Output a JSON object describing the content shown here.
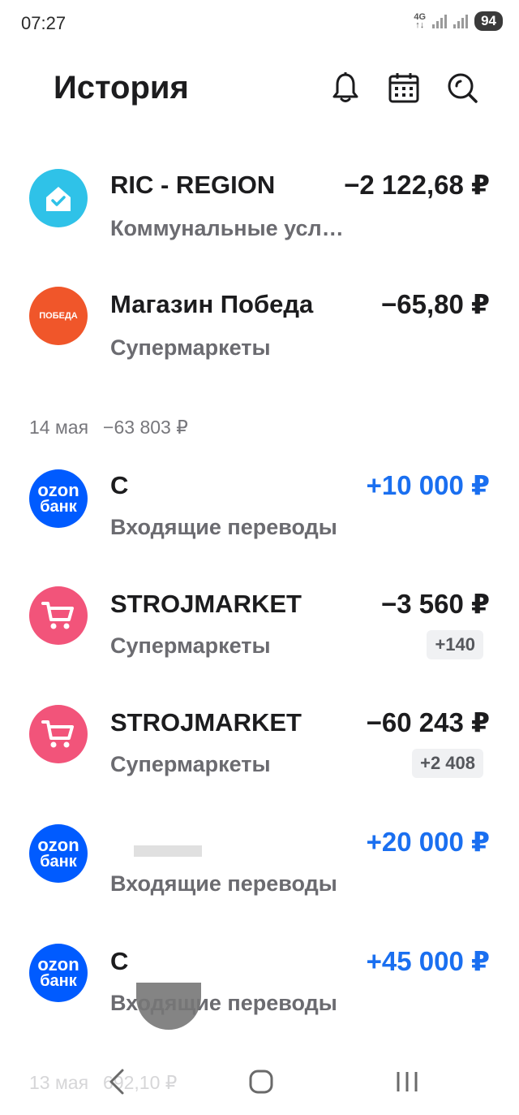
{
  "status": {
    "time": "07:27",
    "network": "4G",
    "battery": "94"
  },
  "header": {
    "title": "История"
  },
  "icons": {
    "bell": "bell-icon",
    "calendar": "calendar-icon",
    "search": "search-icon"
  },
  "colors": {
    "accent_blue": "#1a6ff0",
    "ozon_blue": "#005bff",
    "store_pink": "#f2547a",
    "pobeda_orange": "#f0562a",
    "ric_cyan": "#2fc2e8"
  },
  "transactions_top": [
    {
      "name": "RIC - REGION",
      "category": "Коммунальные усл…",
      "amount": "−2 122,68 ₽",
      "direction": "out",
      "logo": "house-logo"
    },
    {
      "name": "Магазин Победа",
      "category": "Супермаркеты",
      "amount": "−65,80 ₽",
      "direction": "out",
      "logo": "pobeda-logo",
      "logo_text": "ПОБЕДА"
    }
  ],
  "day_groups": [
    {
      "date": "14 мая",
      "total": "−63 803 ₽",
      "transactions": [
        {
          "name": "С",
          "category": "Входящие переводы",
          "amount": "+10 000 ₽",
          "direction": "in",
          "logo": "ozon-bank-logo"
        },
        {
          "name": "STROJMARKET",
          "category": "Супермаркеты",
          "amount": "−3 560 ₽",
          "direction": "out",
          "logo": "cart-logo",
          "bonus": "+140"
        },
        {
          "name": "STROJMARKET",
          "category": "Супермаркеты",
          "amount": "−60 243 ₽",
          "direction": "out",
          "logo": "cart-logo",
          "bonus": "+2 408"
        },
        {
          "name": "",
          "category": "Входящие переводы",
          "amount": "+20 000 ₽",
          "direction": "in",
          "logo": "ozon-bank-logo"
        },
        {
          "name": "С",
          "category": "Входящие переводы",
          "amount": "+45 000 ₽",
          "direction": "in",
          "logo": "ozon-bank-logo"
        }
      ]
    },
    {
      "date": "13 мая",
      "total": "692,10 ₽"
    }
  ],
  "ozon_logo": {
    "line1": "ozon",
    "line2": "банк"
  }
}
